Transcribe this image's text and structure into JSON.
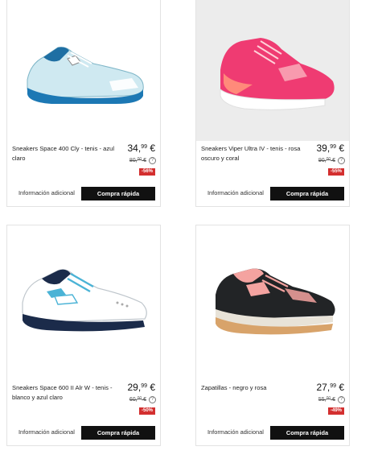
{
  "products": [
    {
      "name": "Sneakers Space 400 Cly - tenis - azul claro",
      "price_int": "34,",
      "price_dec": "99",
      "currency": " €",
      "old_int": "80,",
      "old_dec": "00",
      "old_currency": " €",
      "discount": "-56%",
      "help_icon": "?",
      "info_label": "Información adicional",
      "quick_label": "Compra rápida",
      "image_icon": "light-blue-tennis-shoe"
    },
    {
      "name": "Sneakers Viper Ultra IV - tenis - rosa oscuro y coral",
      "price_int": "39,",
      "price_dec": "99",
      "currency": " €",
      "old_int": "90,",
      "old_dec": "00",
      "old_currency": " €",
      "discount": "-55%",
      "help_icon": "?",
      "info_label": "Información adicional",
      "quick_label": "Compra rápida",
      "image_icon": "pink-tennis-shoe"
    },
    {
      "name": "Sneakers Space 600 II Alr W - tenis - blanco y azul claro",
      "price_int": "29,",
      "price_dec": "99",
      "currency": " €",
      "old_int": "60,",
      "old_dec": "00",
      "old_currency": " €",
      "discount": "-50%",
      "help_icon": "?",
      "info_label": "Información adicional",
      "quick_label": "Compra rápida",
      "image_icon": "white-blue-tennis-shoe"
    },
    {
      "name": "Zapatillas - negro y rosa",
      "price_int": "27,",
      "price_dec": "99",
      "currency": " €",
      "old_int": "55,",
      "old_dec": "00",
      "old_currency": " €",
      "discount": "-49%",
      "help_icon": "?",
      "info_label": "Información adicional",
      "quick_label": "Compra rápida",
      "image_icon": "black-pink-indoor-shoe"
    }
  ],
  "colors": {
    "discount_badge": "#d32f2f",
    "quick_button": "#111111",
    "card_border": "#e3e3e3",
    "image_bg_pink": "#ececec"
  }
}
